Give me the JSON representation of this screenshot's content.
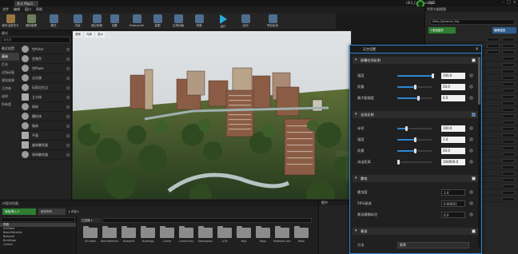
{
  "titlebar": {
    "tab": "关卡 Map1",
    "ue": "UE4_Community2",
    "ws": "DDC",
    "prj2": "",
    "proj": "UE4_Community2"
  },
  "menu": [
    "文件",
    "编辑",
    "窗口",
    "帮助"
  ],
  "toolbar": {
    "buttons": [
      {
        "label": "保存当前关卡",
        "kind": "o"
      },
      {
        "label": "源码管理",
        "kind": "g"
      },
      {
        "label": "模式",
        "kind": ""
      },
      {
        "label": "内容",
        "kind": ""
      },
      {
        "label": "虚幻商城",
        "kind": ""
      },
      {
        "label": "设置",
        "kind": ""
      },
      {
        "label": "Datasmith",
        "kind": ""
      },
      {
        "label": "蓝图",
        "kind": ""
      },
      {
        "label": "过场动画",
        "kind": ""
      },
      {
        "label": "构建",
        "kind": ""
      },
      {
        "label": "运行",
        "kind": "play"
      },
      {
        "label": "启动",
        "kind": ""
      },
      {
        "label": "项目启动",
        "kind": ""
      }
    ]
  },
  "modes": {
    "header": "模式",
    "search_placeholder": "搜索类",
    "categories": [
      "最近放置",
      "基础",
      "灯光",
      "过场动画",
      "视觉效果",
      "几何体",
      "体积",
      "所有类"
    ],
    "selected_category_index": 1,
    "items": [
      {
        "label": "空Actor",
        "shape": "sphere"
      },
      {
        "label": "空角色",
        "shape": "sphere"
      },
      {
        "label": "空Pawn",
        "shape": "sphere"
      },
      {
        "label": "点光源",
        "shape": "sphere"
      },
      {
        "label": "玩家出生点",
        "shape": "sphere"
      },
      {
        "label": "立方体",
        "shape": "cube"
      },
      {
        "label": "球体",
        "shape": "sphere"
      },
      {
        "label": "圆柱体",
        "shape": "sphere"
      },
      {
        "label": "锥体",
        "shape": "sphere"
      },
      {
        "label": "平面",
        "shape": "cube"
      },
      {
        "label": "盒体触发器",
        "shape": "cube"
      },
      {
        "label": "球体触发器",
        "shape": "sphere"
      }
    ]
  },
  "viewport": {
    "buttons": [
      "透视",
      "光照",
      "显示"
    ]
  },
  "rightpanel": {
    "outliner_header": "世界大纲视图",
    "actor_name": "Ultra_Dynamic_Sky",
    "add_component": "+添加组件",
    "edit_blueprint": "编辑蓝图"
  },
  "content_browser": {
    "header": "内容浏览器",
    "add_new": "添加/导入 ▾",
    "import": "保存所有",
    "path": "▸ 内容 ▸",
    "filter_label": "过滤器 ▾",
    "tree": [
      "内容",
      "00Video",
      "BasicMaterial",
      "Bakyard",
      "Buildings",
      "Carrier"
    ],
    "tree_selected_index": 0,
    "folders": [
      "00-Video",
      "BasicMaterial",
      "Blueprint",
      "Buildings",
      "Carrier",
      "Community",
      "Developers",
      "LUTs",
      "Map",
      "Maps",
      "Materials Library",
      "Mesh"
    ]
  },
  "details": {
    "header": "细节"
  },
  "settings_panel": {
    "title": "天空设置",
    "sections": [
      {
        "label": "屏幕空间反射",
        "checked": false
      },
      {
        "label": "全局反射",
        "checked": true
      },
      {
        "label": "雾效",
        "checked": false
      },
      {
        "label": "景深",
        "checked": false
      }
    ],
    "ssr": [
      {
        "label": "强度",
        "value": "100.0",
        "fill": 1.0
      },
      {
        "label": "质量",
        "value": "50.0",
        "fill": 0.5
      },
      {
        "label": "最大粗糙度",
        "value": "0.6",
        "fill": 0.6
      }
    ],
    "gi": [
      {
        "label": "半径",
        "value": "100.0",
        "fill": 0.25
      },
      {
        "label": "强度",
        "value": "1.0",
        "fill": 0.5
      },
      {
        "label": "质量",
        "value": "50.0",
        "fill": 0.5
      },
      {
        "label": "淡出距离",
        "value": "100000.0",
        "fill": 0.0
      }
    ],
    "fog": [
      {
        "label": "雾浓度",
        "value": "1.0"
      },
      {
        "label": "50%衰减",
        "value": "0.00001"
      },
      {
        "label": "景深模糊半径",
        "value": "0.0"
      }
    ],
    "dof": [
      {
        "label": "方法",
        "value": "散景"
      }
    ]
  },
  "colors": {
    "accent": "#2f86d6",
    "green": "#2e7d32",
    "panel": "#202020"
  }
}
